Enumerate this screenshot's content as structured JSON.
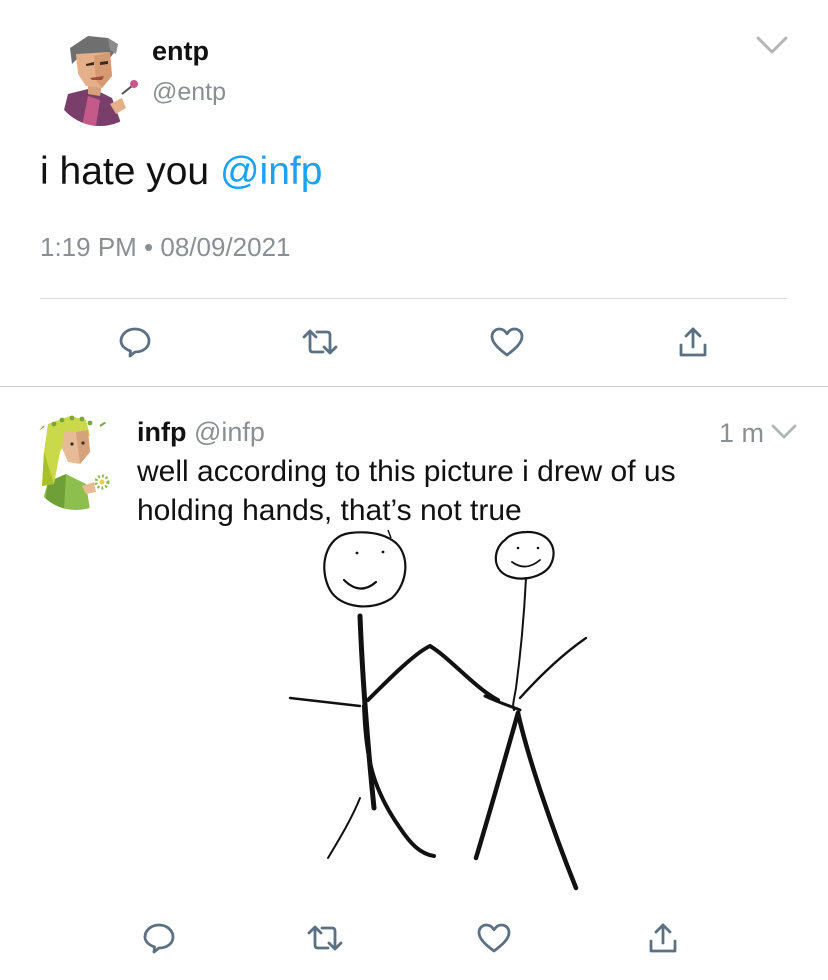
{
  "main_tweet": {
    "name": "entp",
    "handle": "@entp",
    "text_prefix": "i hate you ",
    "mention": "@infp",
    "timestamp": "1:19 PM • 08/09/2021",
    "avatar_icon": "entp-avatar-icon",
    "menu_icon": "chevron-down-icon"
  },
  "reply_tweet": {
    "name": "infp",
    "handle": "@infp",
    "age": "1 m",
    "text_line1": "well according to this picture i drew of us",
    "text_line2": "holding hands, that’s not true",
    "avatar_icon": "infp-avatar-icon",
    "image_icon": "stick-figures-drawing",
    "menu_icon": "chevron-down-icon"
  },
  "actions": {
    "reply_icon": "reply-icon",
    "retweet_icon": "retweet-icon",
    "like_icon": "heart-icon",
    "share_icon": "share-icon"
  },
  "colors": {
    "accent": "#1da1f2",
    "muted": "#8a8f94",
    "icon": "#5b7083",
    "divider": "#d7dadd"
  }
}
